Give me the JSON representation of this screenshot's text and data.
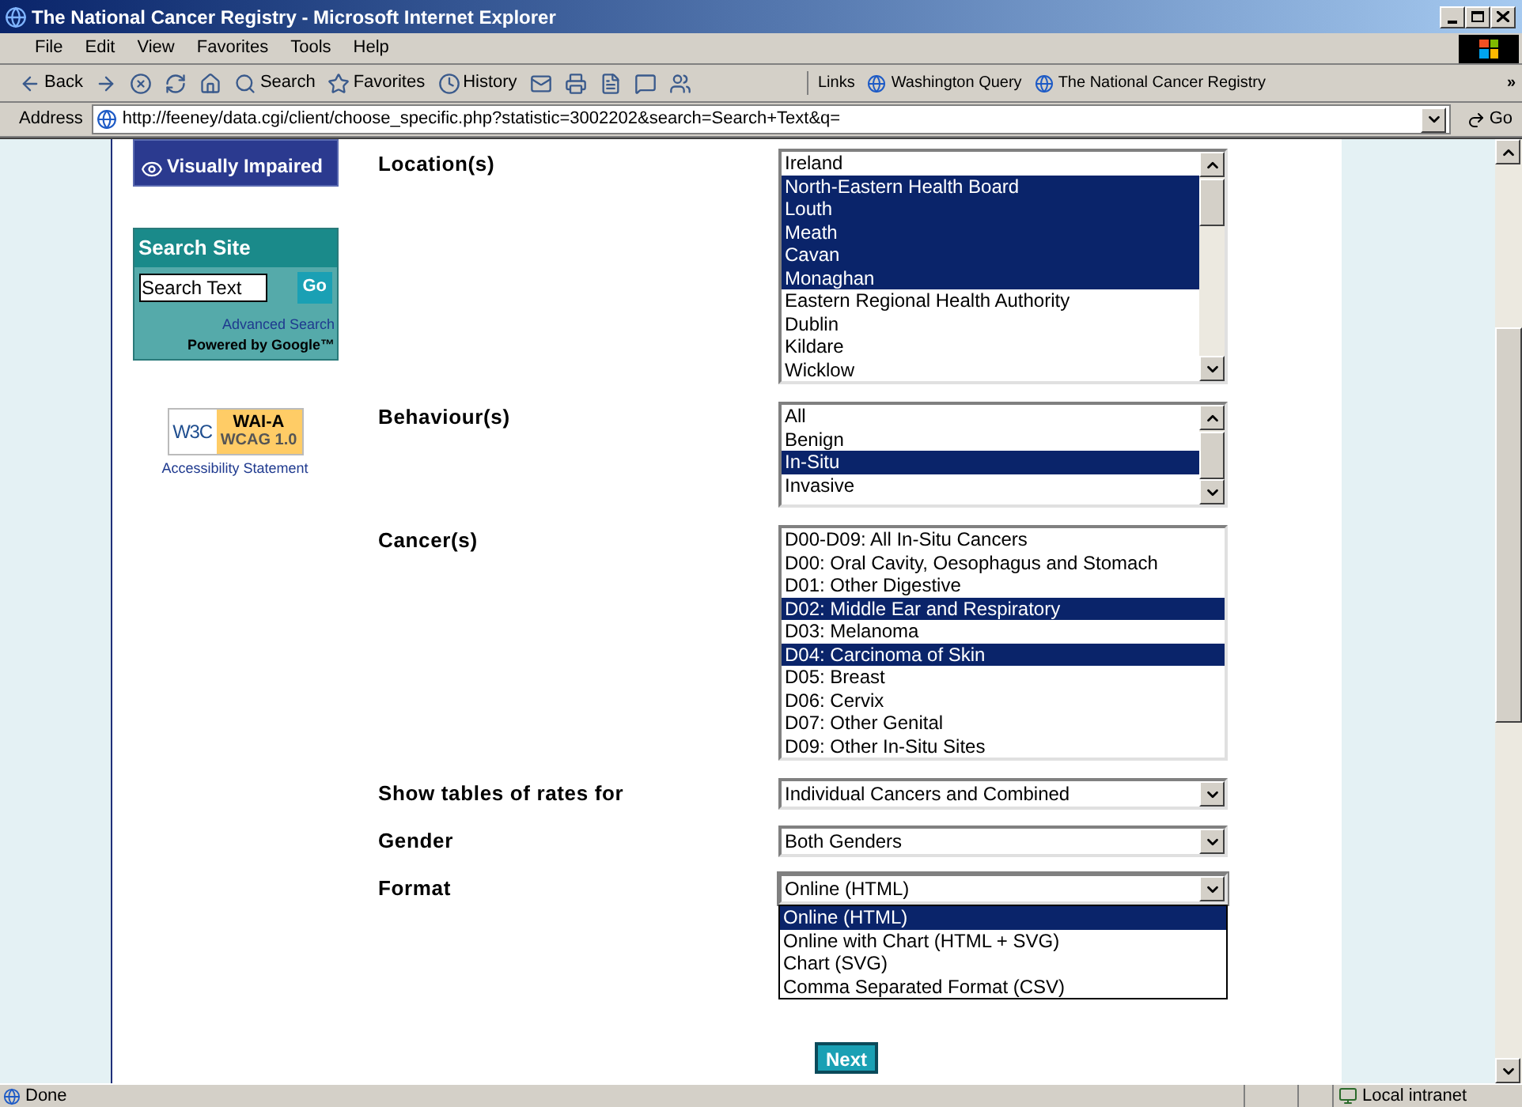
{
  "window": {
    "title": "The National Cancer Registry - Microsoft Internet Explorer"
  },
  "menu": [
    "File",
    "Edit",
    "View",
    "Favorites",
    "Tools",
    "Help"
  ],
  "toolbar": [
    {
      "kind": "back",
      "label": "Back"
    },
    {
      "kind": "forward"
    },
    {
      "kind": "stop"
    },
    {
      "kind": "refresh"
    },
    {
      "kind": "home"
    },
    {
      "kind": "search",
      "label": "Search"
    },
    {
      "kind": "favorites",
      "label": "Favorites"
    },
    {
      "kind": "history",
      "label": "History"
    },
    {
      "kind": "mail"
    },
    {
      "kind": "print"
    },
    {
      "kind": "edit"
    },
    {
      "kind": "discuss"
    },
    {
      "kind": "messenger"
    }
  ],
  "links": {
    "label": "Links",
    "items": [
      "Washington Query",
      "The National Cancer Registry"
    ],
    "more": "»"
  },
  "address": {
    "label": "Address",
    "url": "http://feeney/data.cgi/client/choose_specific.php?statistic=3002202&search=Search+Text&q=",
    "go": "Go"
  },
  "sidebar": {
    "visually_impaired": "Visually Impaired",
    "search": {
      "title": "Search Site",
      "value": "Search Text",
      "go": "Go",
      "advanced": "Advanced Search",
      "powered": "Powered by Google™"
    },
    "badge": {
      "w3c": "W3C",
      "level": "WAI-A",
      "standard": "WCAG 1.0"
    },
    "accessibility": "Accessibility Statement"
  },
  "form": [
    {
      "kind": "listbox",
      "label": "Location(s)",
      "options": [
        {
          "text": "Ireland",
          "selected": false
        },
        {
          "text": "North-Eastern Health Board",
          "selected": true
        },
        {
          "text": "Louth",
          "selected": true
        },
        {
          "text": "Meath",
          "selected": true
        },
        {
          "text": "Cavan",
          "selected": true
        },
        {
          "text": "Monaghan",
          "selected": true
        },
        {
          "text": "Eastern Regional Health Authority",
          "selected": false
        },
        {
          "text": "Dublin",
          "selected": false
        },
        {
          "text": "Kildare",
          "selected": false
        },
        {
          "text": "Wicklow",
          "selected": false
        }
      ]
    },
    {
      "kind": "listbox",
      "label": "Behaviour(s)",
      "options": [
        {
          "text": "All",
          "selected": false
        },
        {
          "text": "Benign",
          "selected": false
        },
        {
          "text": "In-Situ",
          "selected": true
        },
        {
          "text": "Invasive",
          "selected": false
        }
      ]
    },
    {
      "kind": "listbox",
      "label": "Cancer(s)",
      "options": [
        {
          "text": "D00-D09: All In-Situ Cancers",
          "selected": false
        },
        {
          "text": "D00: Oral Cavity, Oesophagus and Stomach",
          "selected": false
        },
        {
          "text": "D01: Other Digestive",
          "selected": false
        },
        {
          "text": "D02: Middle Ear and Respiratory",
          "selected": true
        },
        {
          "text": "D03: Melanoma",
          "selected": false
        },
        {
          "text": "D04: Carcinoma of Skin",
          "selected": true
        },
        {
          "text": "D05: Breast",
          "selected": false
        },
        {
          "text": "D06: Cervix",
          "selected": false
        },
        {
          "text": "D07: Other Genital",
          "selected": false
        },
        {
          "text": "D09: Other In-Situ Sites",
          "selected": false
        }
      ]
    },
    {
      "kind": "dropdown",
      "label": "Show tables of rates for",
      "value": "Individual Cancers and Combined",
      "expanded": false
    },
    {
      "kind": "dropdown",
      "label": "Gender",
      "value": "Both Genders",
      "expanded": false
    },
    {
      "kind": "dropdown",
      "label": "Format",
      "value": "Online (HTML)",
      "expanded": true,
      "options": [
        {
          "text": "Online (HTML)",
          "selected": true
        },
        {
          "text": "Online with Chart (HTML + SVG)",
          "selected": false
        },
        {
          "text": "Chart (SVG)",
          "selected": false
        },
        {
          "text": "Comma Separated Format (CSV)",
          "selected": false
        }
      ]
    }
  ],
  "next": "Next",
  "status_bar": {
    "text": "Done",
    "zone": "Local intranet"
  }
}
